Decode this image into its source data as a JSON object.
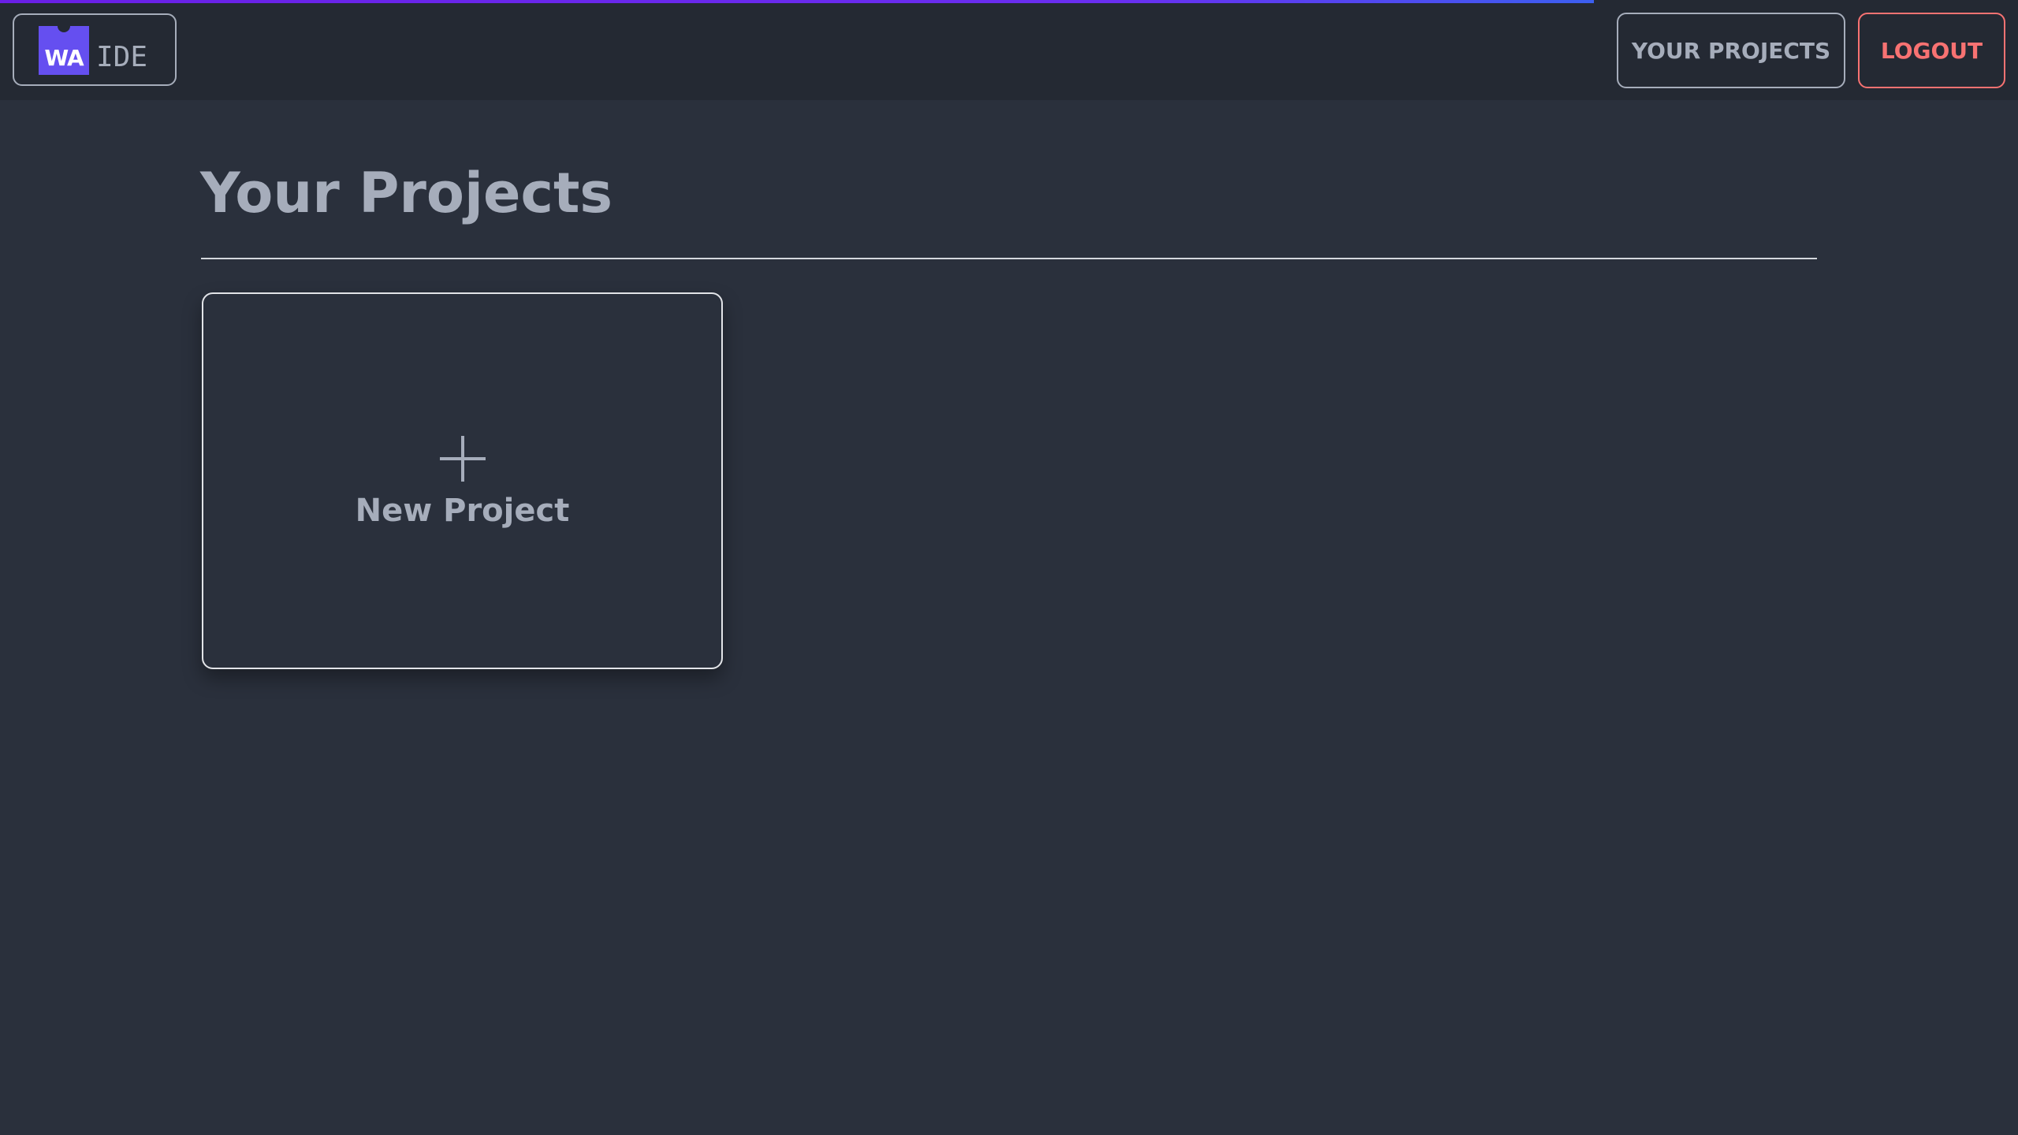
{
  "progress": {
    "fraction": 0.79
  },
  "navbar": {
    "logo": {
      "mark": "WA",
      "text": "IDE"
    },
    "your_projects_label": "YOUR PROJECTS",
    "logout_label": "LOGOUT"
  },
  "main": {
    "title": "Your Projects",
    "new_project_label": "New Project"
  },
  "colors": {
    "background": "#2a303c",
    "navbar": "#242933",
    "text": "#a6adbb",
    "logo_mark": "#654ff0",
    "logout": "#f87272",
    "progress": "#6a1fe6"
  },
  "icons": {
    "new_project": "plus-icon",
    "logo": "webassembly-logo-icon"
  }
}
